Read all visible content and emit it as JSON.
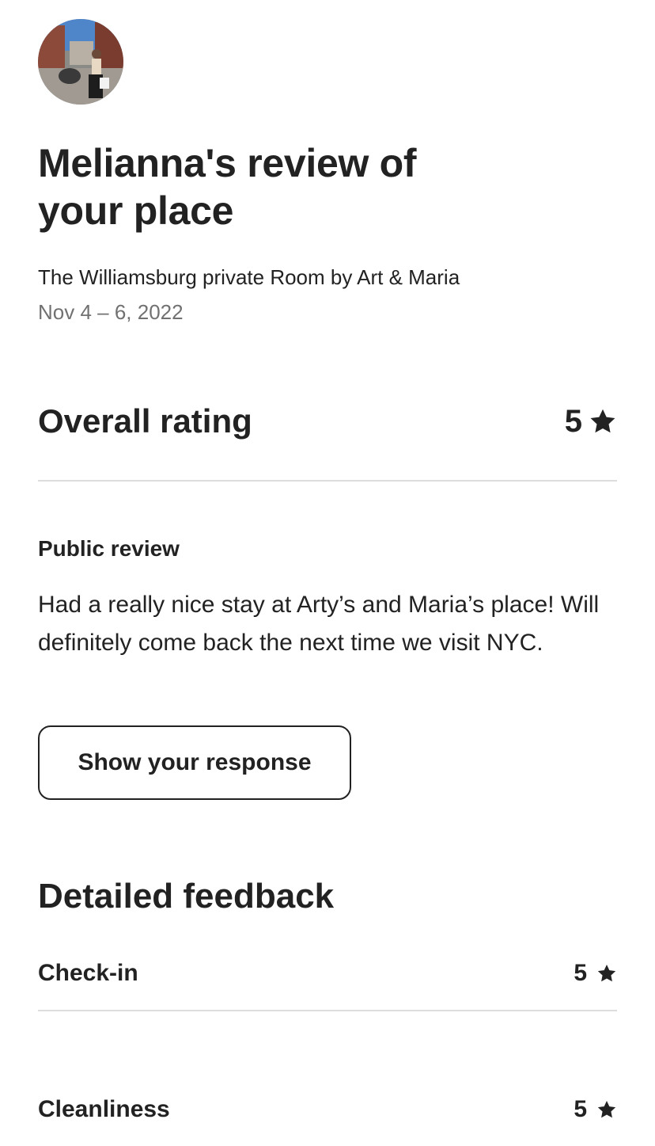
{
  "review": {
    "title": "Melianna's review of your place",
    "listing_name": "The Williamsburg private Room by Art & Maria",
    "dates": "Nov 4 – 6, 2022"
  },
  "overall": {
    "label": "Overall rating",
    "value": "5",
    "icon": "star-icon"
  },
  "public_review": {
    "label": "Public review",
    "text": "Had a really nice stay at Arty’s and Maria’s place! Will definitely come back the next time we visit NYC.",
    "button_label": "Show your response"
  },
  "detailed_feedback": {
    "title": "Detailed feedback",
    "items": [
      {
        "label": "Check-in",
        "value": "5",
        "icon": "star-icon"
      },
      {
        "label": "Cleanliness",
        "value": "5",
        "icon": "star-icon"
      }
    ]
  },
  "colors": {
    "text": "#222222",
    "secondary_text": "#717171",
    "divider": "#dddddd"
  }
}
